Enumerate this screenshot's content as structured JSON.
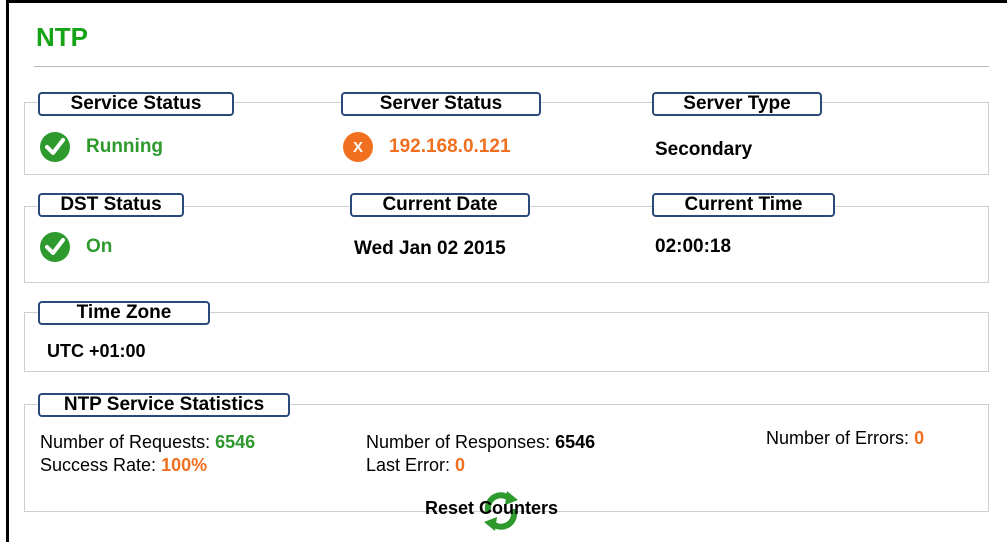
{
  "page": {
    "title": "NTP"
  },
  "service_status": {
    "label": "Service Status",
    "value": "Running",
    "icon": "check-icon"
  },
  "server_status": {
    "label": "Server Status",
    "value": "192.168.0.121",
    "icon": "error-x-icon",
    "icon_glyph": "X"
  },
  "server_type": {
    "label": "Server Type",
    "value": "Secondary"
  },
  "dst_status": {
    "label": "DST Status",
    "value": "On",
    "icon": "check-icon"
  },
  "current_date": {
    "label": "Current Date",
    "value": "Wed Jan 02 2015"
  },
  "current_time": {
    "label": "Current Time",
    "value": "02:00:18"
  },
  "time_zone": {
    "label": "Time Zone",
    "value": "UTC +01:00"
  },
  "statistics": {
    "label": "NTP Service Statistics",
    "requests_label": "Number of Requests:",
    "requests_value": "6546",
    "responses_label": "Number of Responses:",
    "responses_value": "6546",
    "errors_label": "Number of Errors:",
    "errors_value": "0",
    "success_label": "Success Rate:",
    "success_value": "100%",
    "last_error_label": "Last Error:",
    "last_error_value": "0",
    "reset_label": "Reset Counters",
    "reset_icon": "refresh-icon"
  },
  "colors": {
    "title_green": "#16a316",
    "ok_green": "#2e9a2e",
    "warn_orange": "#f07020",
    "tab_border": "#2a4a79"
  }
}
